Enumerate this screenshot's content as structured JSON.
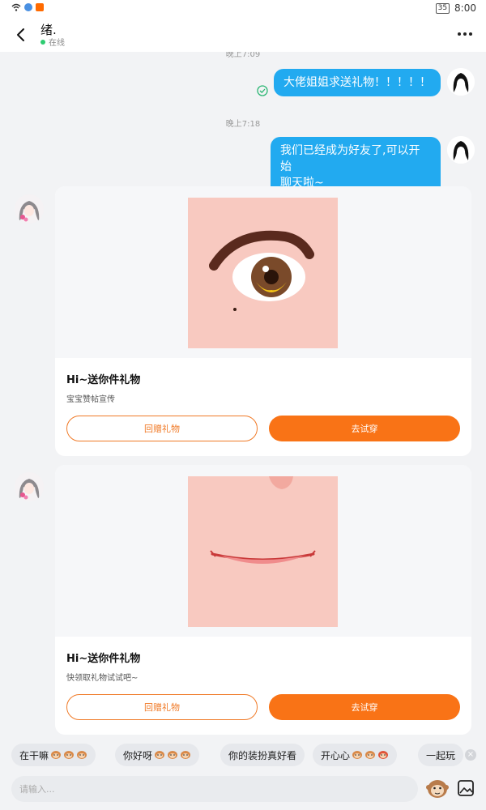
{
  "status_bar": {
    "time": "8:00",
    "battery": "35"
  },
  "header": {
    "title": "绪.",
    "status": "在线"
  },
  "chat": {
    "timestamps": [
      "晚上7:09",
      "晚上7:18"
    ],
    "messages": [
      {
        "text": "大佬姐姐求送礼物！！！！！"
      },
      {
        "text_line1": "我们已经成为好友了,可以开始",
        "text_line2": "聊天啦~"
      }
    ],
    "gift_cards": [
      {
        "title": "Hi~送你件礼物",
        "subtitle": "宝宝赞帖宣传",
        "return_button": "回赠礼物",
        "try_button": "去试穿"
      },
      {
        "title": "Hi~送你件礼物",
        "subtitle": "快领取礼物试试吧~",
        "return_button": "回赠礼物",
        "try_button": "去试穿"
      }
    ]
  },
  "quick_replies": [
    "在干嘛",
    "你好呀",
    "你的装扮真好看",
    "开心心",
    "一起玩"
  ],
  "input": {
    "placeholder": "请输入..."
  },
  "colors": {
    "bubble": "#22aaf0",
    "accent": "#f97316",
    "online": "#2ecc71"
  }
}
